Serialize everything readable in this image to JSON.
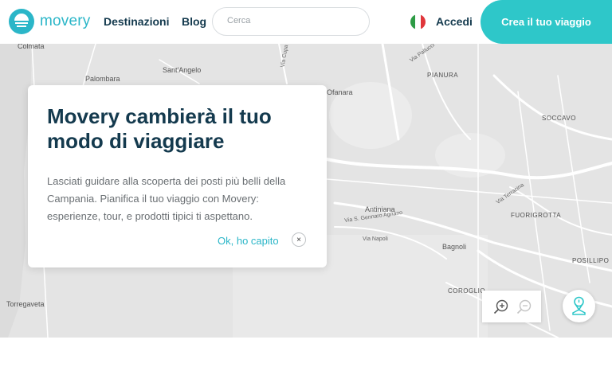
{
  "header": {
    "logo_text": "movery",
    "nav": [
      "Destinazioni",
      "Blog"
    ],
    "search_placeholder": "Cerca",
    "login": "Accedi",
    "cta": "Crea il tuo viaggio",
    "colors": {
      "brand": "#2bb6c8",
      "cta": "#2ec7c9",
      "dark": "#143a4e"
    }
  },
  "map": {
    "places": [
      "Palombara",
      "Sant'Angelo",
      "Antiniana",
      "Bagnoli",
      "Torregaveta",
      "Colmata",
      "Ofanara"
    ],
    "districts": [
      "PIANURA",
      "SOCCAVO",
      "FUORIGROTTA",
      "POSILLIPO",
      "COROGLIO"
    ],
    "streets": [
      "Via S. Gennaro Agnano",
      "Via Napoli",
      "Via Terracina",
      "Via Pallucci",
      "Via Cupa"
    ]
  },
  "popup": {
    "title": "Movery cambierà il tuo modo di viaggiare",
    "text": "Lasciati guidare alla scoperta dei posti più belli della Campania. Pianifica il tuo viaggio con Movery: esperienze, tour, e prodotti tipici ti aspettano.",
    "ok": "Ok, ho capito",
    "close": "×"
  },
  "controls": {
    "zoom_in_icon": "zoom-in-icon",
    "zoom_out_icon": "zoom-out-icon",
    "locate_icon": "map-pin-icon"
  }
}
